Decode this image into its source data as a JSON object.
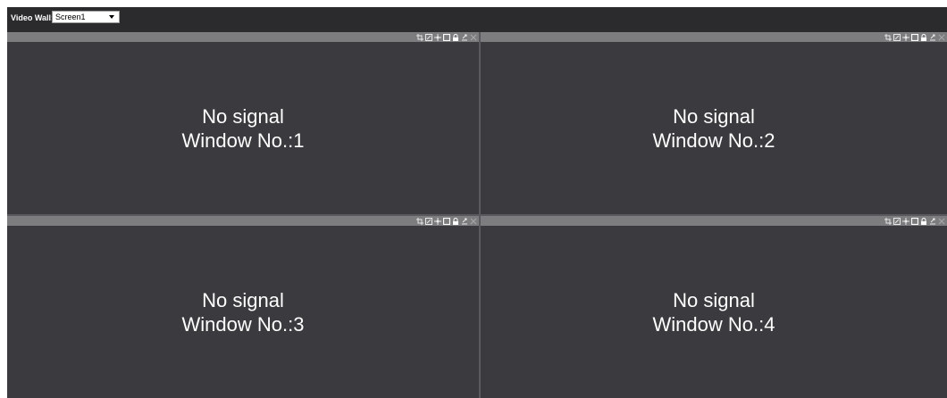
{
  "topbar": {
    "label": "Video Wall:",
    "selected_screen": "Screen1"
  },
  "windows": [
    {
      "line1": "No signal",
      "line2": "Window No.:1"
    },
    {
      "line1": "No signal",
      "line2": "Window No.:2"
    },
    {
      "line1": "No signal",
      "line2": "Window No.:3"
    },
    {
      "line1": "No signal",
      "line2": "Window No.:4"
    }
  ],
  "toolbar_icons": [
    "crop-icon",
    "edit-icon",
    "move-icon",
    "fullscreen-icon",
    "lock-icon",
    "export-icon",
    "close-icon"
  ],
  "colors": {
    "background": "#2a2a2c",
    "window": "#3b3a3f",
    "titlebar": "#7d7d80",
    "text": "#ffffff"
  }
}
